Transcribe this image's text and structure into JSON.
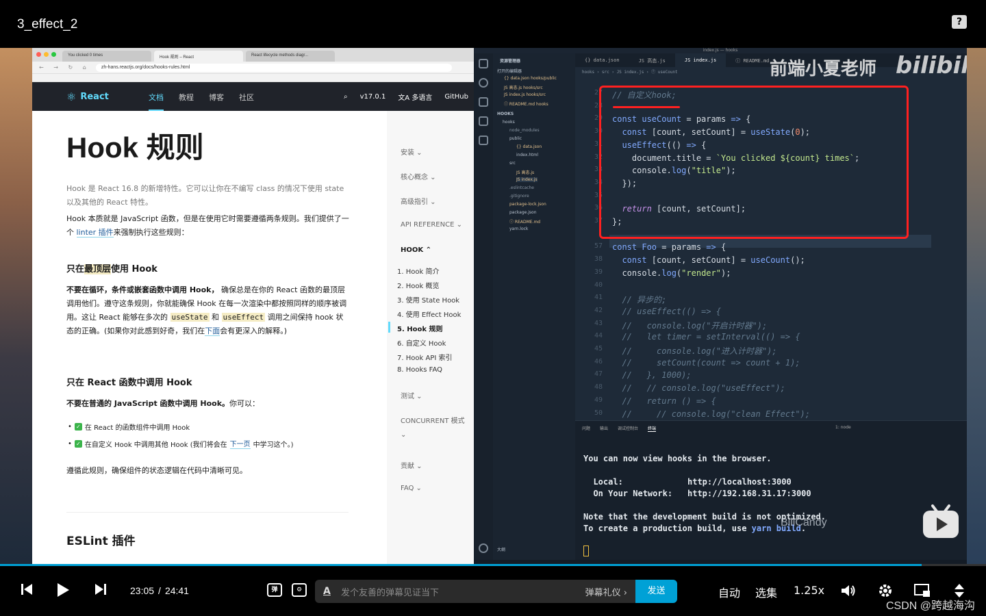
{
  "header": {
    "title": "3_effect_2",
    "help_icon": "?"
  },
  "browser": {
    "tabs": [
      "You clicked 0 times",
      "Hook 规则 – React",
      "React lifecycle methods diagr..."
    ],
    "url": "zh-hans.reactjs.org/docs/hooks-rules.html",
    "nav": {
      "brand": "React",
      "links": [
        "文档",
        "教程",
        "博客",
        "社区"
      ],
      "version": "v17.0.1",
      "language": "多语言",
      "github": "GitHub"
    },
    "doc": {
      "title": "Hook 规则",
      "intro": "Hook 是 React 16.8 的新增特性。它可以让你在不编写 class 的情况下使用 state 以及其他的 React 特性。",
      "para1_a": "Hook 本质就是 JavaScript 函数，但是在使用它时需要遵循两条规则。我们提供了一个 ",
      "para1_link": "linter 插件",
      "para1_b": "来强制执行这些规则：",
      "h_top_a": "只在",
      "h_top_b": "最顶层",
      "h_top_c": "使用 Hook",
      "para2_bold": "不要在循环，条件或嵌套函数中调用 Hook，",
      "para2_a": " 确保总是在你的 React 函数的最顶层调用他们。遵守这条规则，你就能确保 Hook 在每一次渲染中都按照同样的顺序被调用。这让 React 能够在多次的 ",
      "para2_code1": "useState",
      "para2_and": " 和 ",
      "para2_code2": "useEffect",
      "para2_b": " 调用之间保持 hook 状态的正确。(如果你对此感到好奇，我们在",
      "para2_link": "下面",
      "para2_c": "会有更深入的解释。)",
      "h_react": "只在 React 函数中调用 Hook",
      "para3_bold": "不要在普通的 JavaScript 函数中调用 Hook。",
      "para3": "你可以：",
      "bullet1": "在 React 的函数组件中调用 Hook",
      "bullet2_a": "在自定义 Hook 中调用其他 Hook (我们将会在",
      "bullet2_link": "下一页",
      "bullet2_b": " 中学习这个。)",
      "para4": "遵循此规则，确保组件的状态逻辑在代码中清晰可见。",
      "h_eslint": "ESLint 插件"
    },
    "sidebar": {
      "sections": [
        "安装 ⌄",
        "核心概念 ⌄",
        "高级指引 ⌄",
        "API REFERENCE ⌄",
        "HOOK ⌃"
      ],
      "hook_items": [
        "1. Hook 简介",
        "2. Hook 概览",
        "3. 使用 State Hook",
        "4. 使用 Effect Hook",
        "5. Hook 规则",
        "6. 自定义 Hook",
        "7. Hook API 索引",
        "8. Hooks FAQ"
      ],
      "after": [
        "测试 ⌄",
        "CONCURRENT 模式",
        "⌄",
        "贡献 ⌄",
        "FAQ ⌄"
      ]
    }
  },
  "editor": {
    "window_title": "index.js — hooks",
    "tabs": [
      "{} data.json",
      "JS 高态.js",
      "JS index.js",
      "ⓘ README.md"
    ],
    "breadcrumbs": "hooks › src › JS index.js › ⓕ useCount",
    "explorer": {
      "header": "资源管理器",
      "open_editors": "打开的编辑器",
      "files": [
        "{} data.json  hooks/public",
        "JS 高态.js  hooks/src",
        "JS index.js  hooks/src",
        "ⓘ README.md  hooks"
      ],
      "project": "HOOKS",
      "tree": [
        "hooks",
        "node_modules",
        "public",
        "{} data.json",
        "index.html",
        "src",
        "JS 高态.js",
        "JS index.js",
        ".eslintcache",
        ".gitignore",
        "package-lock.json",
        "package.json",
        "ⓘ README.md",
        "yarn.lock"
      ],
      "outline": "大纲"
    },
    "watermark": "前端小夏老师",
    "bilibili": "bilibili",
    "code_lines": [
      {
        "n": "27",
        "html": "<span class='cmt'>// 自定义hook;</span>"
      },
      {
        "n": "28",
        "html": ""
      },
      {
        "n": "29",
        "html": "<span class='kw'>const</span> <span class='fn'>useCount</span> = params <span class='kw'>=&gt;</span> {"
      },
      {
        "n": "30",
        "html": "  <span class='kw'>const</span> [count, setCount] = <span class='fn'>useState</span>(<span class='num'>0</span>);"
      },
      {
        "n": "31",
        "html": "  <span class='fn'>useEffect</span>(() <span class='kw'>=&gt;</span> {"
      },
      {
        "n": "32",
        "html": "    document.title = <span class='str'>`You clicked ${count} times`</span>;"
      },
      {
        "n": "33",
        "html": "    console.<span class='fn'>log</span>(<span class='str'>\"title\"</span>);"
      },
      {
        "n": "34",
        "html": "  });"
      },
      {
        "n": "35",
        "html": ""
      },
      {
        "n": "36",
        "html": "  <span class='ret'>return</span> [count, setCount];"
      },
      {
        "n": "37",
        "html": "};"
      },
      {
        "n": "",
        "html": ""
      },
      {
        "n": "57",
        "html": "<span class='kw'>const</span> <span class='fn'>Foo</span> = params <span class='kw'>=&gt;</span> {"
      },
      {
        "n": "38",
        "html": "  <span class='kw'>const</span> [count, setCount] = <span class='fn'>useCount</span>();"
      },
      {
        "n": "39",
        "html": "  console.<span class='fn'>log</span>(<span class='str'>\"render\"</span>);"
      },
      {
        "n": "40",
        "html": ""
      },
      {
        "n": "41",
        "html": "  <span class='cmt'>// 异步的;</span>"
      },
      {
        "n": "42",
        "html": "  <span class='cmt'>// useEffect(() =&gt; {</span>"
      },
      {
        "n": "43",
        "html": "  <span class='cmt'>//   console.log(\"开启计时器\");</span>"
      },
      {
        "n": "44",
        "html": "  <span class='cmt'>//   let timer = setInterval(() =&gt; {</span>"
      },
      {
        "n": "45",
        "html": "  <span class='cmt'>//     console.log(\"进入计时器\");</span>"
      },
      {
        "n": "46",
        "html": "  <span class='cmt'>//     setCount(count =&gt; count + 1);</span>"
      },
      {
        "n": "47",
        "html": "  <span class='cmt'>//   }, 1000);</span>"
      },
      {
        "n": "48",
        "html": "  <span class='cmt'>//   // console.log(\"useEffect\");</span>"
      },
      {
        "n": "49",
        "html": "  <span class='cmt'>//   return () =&gt; {</span>"
      },
      {
        "n": "50",
        "html": "  <span class='cmt'>//     // console.log(\"clean Effect\");</span>"
      }
    ],
    "terminal": {
      "tabs": [
        "问题",
        "输出",
        "调试控制台",
        "终端"
      ],
      "shell": "1: node",
      "line1": "You can now view hooks in the browser.",
      "local_label": "  Local:",
      "local_url": "http://localhost:3000",
      "network_label": "  On Your Network:",
      "network_url": "http://192.168.31.17:3000",
      "note1": "Note that the development build is not optimized.",
      "note2_a": "To create a production build, use ",
      "note2_cmd": "yarn build",
      "note2_b": ".",
      "overlay": "BiliCandy"
    }
  },
  "player": {
    "current_time": "23:05",
    "separator": "/",
    "duration": "24:41",
    "progress_fraction": 0.935,
    "danmaku_placeholder": "发个友善的弹幕见证当下",
    "danmaku_etiquette": "弹幕礼仪 ›",
    "send_label": "发送",
    "quality": "自动",
    "episodes": "选集",
    "speed": "1.25x",
    "csdn": "CSDN @跨越海沟",
    "accent": "#00a1d6"
  }
}
